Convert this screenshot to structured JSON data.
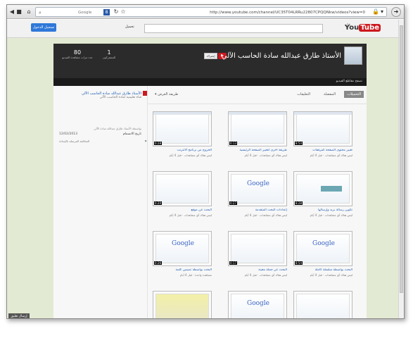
{
  "browser": {
    "url": "http://www.youtube.com/channel/UC35T04LRRu22807CPQQNkw/videos?view=0",
    "search_engine_badge": "8",
    "search_text": "Google"
  },
  "youtube": {
    "logo_you": "You",
    "logo_tube": "Tube",
    "logo_tm": "SA",
    "upload_label": "تحميل",
    "signin_label": "تسجيل الدخول"
  },
  "channel": {
    "title": "الأستاذ طارق عبدالله سادة الحاسب الآلي",
    "subscribe_label": "إشتراك",
    "subscribers_count": "1",
    "subscribers_label": "المشتركون",
    "views_count": "80",
    "views_label": "عدد مرات مشاهدة الفيديو",
    "browse_label": "تصفح مقاطع الفيديو"
  },
  "tabs": {
    "videos": "التحميلات",
    "favorites": "المفضلة",
    "comments": "التعليقات",
    "sort": "طريقة العرض"
  },
  "about": {
    "title": "الأستاذ طارق عبدالله سادة الحاسب الآلي",
    "subtitle": "قناة تعليمية لمادة الحاسب الآلي",
    "desc": "بواسطة الأستاذ طارق عبدالله سادة الآلي",
    "joined_label": "تاريخ الانضمام",
    "joined_date": "12/02/2013",
    "flag_label": "الإبلاغ عن إساءة",
    "flag_action": "المخالفة المرسلة بالإساءة"
  },
  "videos": [
    {
      "duration": "8:54",
      "title": "تغيير محتوى الصفحة كمرفقات",
      "meta": "ليس هناك أي مشاهدات · قبل 4 أيام"
    },
    {
      "duration": "0:13",
      "title": "طريقة أخرى لتغيير الصفحة الرئيسية",
      "meta": "ليس هناك أي مشاهدات · قبل 4 أيام"
    },
    {
      "duration": "0:28",
      "title": "الخروج من برنامج الانترنت",
      "meta": "ليس هناك أي مشاهدات · قبل 4 أيام"
    },
    {
      "duration": "8:28",
      "title": "تكوين رسالة بريد وإرسالها",
      "meta": "ليس هناك أي مشاهدات · قبل 4 أيام"
    },
    {
      "duration": "0:27",
      "title": "إعدادات البحث المتقدمة",
      "meta": "ليس هناك أي مشاهدات · قبل 4 أيام"
    },
    {
      "duration": "0:20",
      "title": "البحث عن موقع",
      "meta": "ليس هناك أي مشاهدات · قبل 4 أيام"
    },
    {
      "duration": "8:54",
      "title": "البحث بواسطة سلسلة كاملة",
      "meta": "ليس هناك أي مشاهدات · قبل 4 أيام"
    },
    {
      "duration": "0:17",
      "title": "البحث عن جملة معينة",
      "meta": "ليس هناك أي مشاهدات · قبل 4 أيام"
    },
    {
      "duration": "0:26",
      "title": "البحث بواسطة تضمين كلمة",
      "meta": "مشاهدة واحدة · قبل 4 أيام"
    }
  ],
  "footer": {
    "feedback_label": "إرسال تعليق"
  },
  "colors": {
    "page_bg": "#e3ead3",
    "banner": "#2b2b2b",
    "link": "#1f5fb5",
    "youtube_red": "#cc181e",
    "signin_blue": "#2f78d8"
  }
}
